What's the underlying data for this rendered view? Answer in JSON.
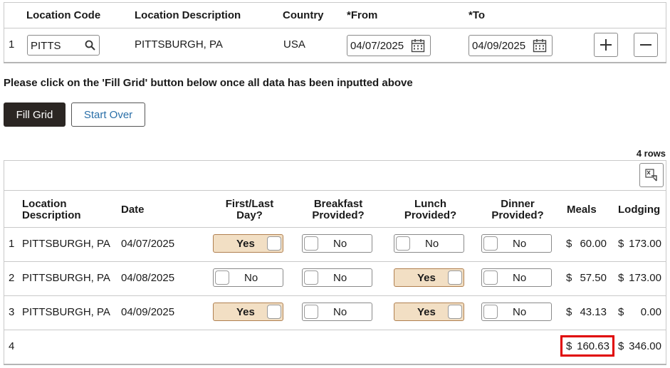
{
  "top_grid": {
    "headers": {
      "location_code": "Location Code",
      "location_description": "Location Description",
      "country": "Country",
      "from": "*From",
      "to": "*To"
    },
    "row": {
      "num": "1",
      "location_code_value": "PITTS",
      "location_description": "PITTSBURGH, PA",
      "country": "USA",
      "from_value": "04/07/2025",
      "to_value": "04/09/2025"
    }
  },
  "instruction": "Please click on the 'Fill Grid' button below once all data has been inputted above",
  "buttons": {
    "fill_grid": "Fill Grid",
    "start_over": "Start Over"
  },
  "result_grid": {
    "row_count": "4 rows",
    "headers": {
      "location_description": "Location Description",
      "date": "Date",
      "first_last_day": "First/Last Day?",
      "breakfast": "Breakfast Provided?",
      "lunch": "Lunch Provided?",
      "dinner": "Dinner Provided?",
      "meals": "Meals",
      "lodging": "Lodging"
    },
    "rows": [
      {
        "num": "1",
        "location": "PITTSBURGH, PA",
        "date": "04/07/2025",
        "first_last": "Yes",
        "breakfast": "No",
        "lunch": "No",
        "dinner": "No",
        "meals_cur": "$",
        "meals": "60.00",
        "lodging_cur": "$",
        "lodging": "173.00"
      },
      {
        "num": "2",
        "location": "PITTSBURGH, PA",
        "date": "04/08/2025",
        "first_last": "No",
        "breakfast": "No",
        "lunch": "Yes",
        "dinner": "No",
        "meals_cur": "$",
        "meals": "57.50",
        "lodging_cur": "$",
        "lodging": "173.00"
      },
      {
        "num": "3",
        "location": "PITTSBURGH, PA",
        "date": "04/09/2025",
        "first_last": "Yes",
        "breakfast": "No",
        "lunch": "Yes",
        "dinner": "No",
        "meals_cur": "$",
        "meals": "43.13",
        "lodging_cur": "$",
        "lodging": "0.00"
      }
    ],
    "total_row": {
      "num": "4",
      "meals_cur": "$",
      "meals": "160.63",
      "lodging_cur": "$",
      "lodging": "346.00"
    }
  },
  "colors": {
    "primary_button": "#2b2623",
    "link_text": "#2a6fa8",
    "yes_fill": "#f2dfc4",
    "highlight_border": "#e00000"
  }
}
